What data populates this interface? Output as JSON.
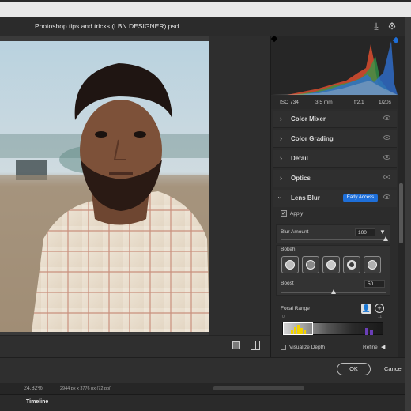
{
  "window": {
    "title": "Photoshop tips and tricks (LBN DESIGNER).psd"
  },
  "photo_meta": {
    "iso": "ISO 734",
    "focal": "3.5 mm",
    "aperture": "f/2.1",
    "shutter": "1/20s"
  },
  "panels": [
    {
      "label": "Color Mixer"
    },
    {
      "label": "Color Grading"
    },
    {
      "label": "Detail"
    },
    {
      "label": "Optics"
    }
  ],
  "lens_blur": {
    "label": "Lens Blur",
    "badge": "Early Access",
    "apply_label": "Apply",
    "apply_checked": true,
    "blur_amount_label": "Blur Amount",
    "blur_amount_value": "100",
    "bokeh_label": "Bokeh",
    "boost_label": "Boost",
    "boost_value": "50",
    "focal_range_label": "Focal Range",
    "focal_left": "0",
    "focal_right": "11",
    "visualize_depth_label": "Visualize Depth",
    "refine_label": "Refine"
  },
  "footer": {
    "ok_label": "OK",
    "cancel_label": "Cancel"
  },
  "status": {
    "zoom": "24.32%",
    "doc_info": "2944 px x 3776 px (72 ppi)"
  },
  "timeline": {
    "label": "Timeline"
  },
  "colors": {
    "accent": "#1e6fd9",
    "panel": "#2c2c2c"
  }
}
